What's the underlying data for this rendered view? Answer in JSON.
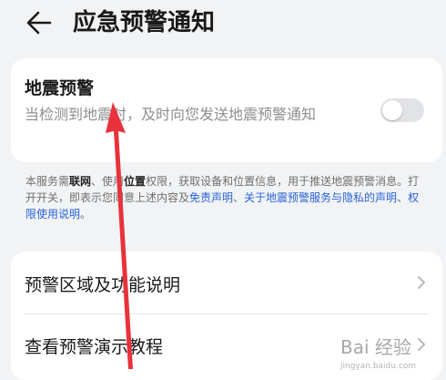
{
  "header": {
    "title": "应急预警通知",
    "back_icon": "arrow-left-icon"
  },
  "earthquake": {
    "title": "地震预警",
    "description": "当检测到地震时，及时向您发送地震预警通知",
    "toggle_on": false
  },
  "notice": {
    "p1": "本服务需",
    "network": "联网",
    "p2": "、使用",
    "location": "位置",
    "p3": "权限，获取设备和位置信息，用于推送地震预警消息。打开开关，即表示您同意上述内容及",
    "link_disclaimer": "免责声明",
    "p4": "、",
    "link_privacy": "关于地震预警服务与隐私的声明",
    "p5": "、",
    "link_permission": "权限使用说明",
    "p6": "。"
  },
  "settings": {
    "items": [
      {
        "label": "预警区域及功能说明"
      },
      {
        "label": "查看预警演示教程"
      }
    ]
  },
  "watermark": {
    "text": "Bai 经验",
    "sub": "jingyan.baidu.com"
  },
  "colors": {
    "link": "#2a62d6",
    "annotation_arrow": "#e8323b",
    "background": "#f1f3f5"
  }
}
